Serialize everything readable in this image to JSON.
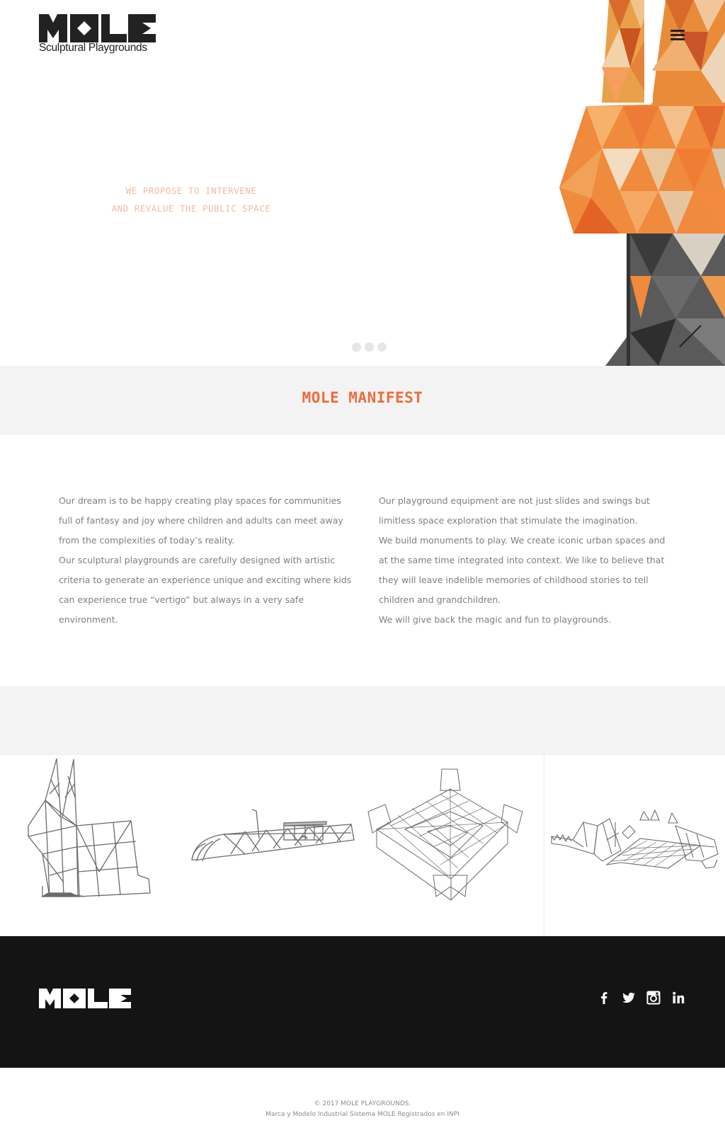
{
  "header": {
    "logo_text": "MOLE",
    "logo_tagline": "Sculptural Playgrounds",
    "menu_icon": "hamburger-menu-icon"
  },
  "hero": {
    "line1": "WE PROPOSE TO INTERVENE",
    "line2": "AND REVALUE THE PUBLIC SPACE",
    "slide_count": 3,
    "accent_color": "#ef6b3c"
  },
  "manifest": {
    "title": "MOLE MANIFEST",
    "left_paragraphs": [
      "Our dream is to be happy creating play spaces for communities full of fantasy and joy where children and adults can meet away from the complexities of today’s reality.",
      "Our sculptural playgrounds are carefully designed with artistic criteria to generate an experience unique and exciting where kids can experience true “vertigo” but always in a very safe environment."
    ],
    "right_paragraphs": [
      "Our playground equipment are not just slides and swings but limitless space exploration that stimulate the imagination.",
      "We build monuments to play. We create iconic urban spaces and at the same time integrated into context. We like to believe that they will leave indelible memories of childhood stories to tell children and grandchildren.",
      "We will give back the magic and fun to playgrounds."
    ]
  },
  "gallery": [
    {
      "icon": "rabbit-sculpture-icon"
    },
    {
      "icon": "submarine-sculpture-icon"
    },
    {
      "icon": "castle-sculpture-icon"
    },
    {
      "icon": "dragon-sculpture-icon"
    }
  ],
  "footer": {
    "logo_text": "MOLE",
    "social": [
      "facebook-icon",
      "twitter-icon",
      "instagram-icon",
      "linkedin-icon"
    ],
    "copyright": "© 2017 MOLE PLAYGROUNDS.",
    "trademark": "Marca y Modelo Industrial Sistema MOLE Registrados en INPI"
  }
}
